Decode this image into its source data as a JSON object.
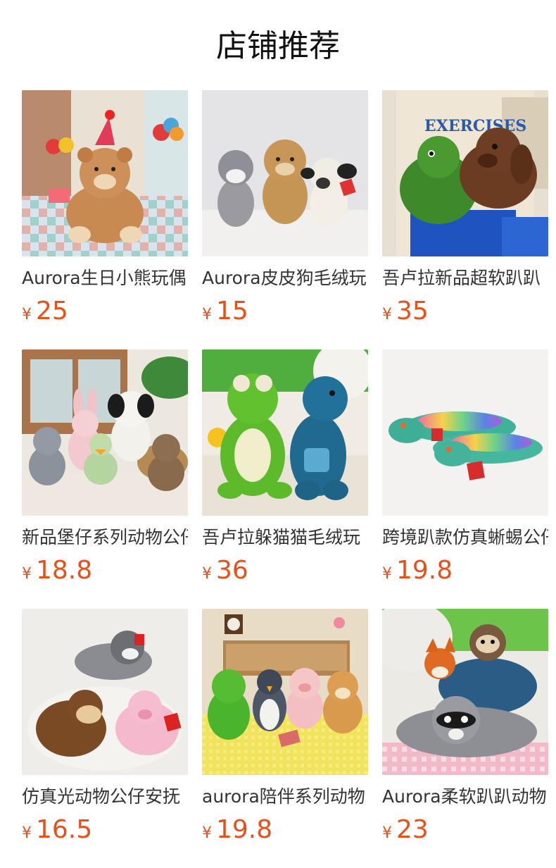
{
  "page_title": "店铺推荐",
  "currency_symbol": "¥",
  "accent_color": "#e8501a",
  "products": [
    {
      "name": "Aurora生日小熊玩偶",
      "price": "25",
      "image": "birthday-bear-image"
    },
    {
      "name": "Aurora皮皮狗毛绒玩",
      "price": "15",
      "image": "puppy-trio-image"
    },
    {
      "name": "吾卢拉新品超软趴趴",
      "price": "35",
      "image": "dino-dog-plush-image"
    },
    {
      "name": "新品堡仔系列动物公仔",
      "price": "18.8",
      "image": "animal-family-image"
    },
    {
      "name": "吾卢拉躲猫猫毛绒玩",
      "price": "36",
      "image": "frog-dino-image"
    },
    {
      "name": "跨境趴款仿真蜥蜴公仔",
      "price": "19.8",
      "image": "lizard-plush-image"
    },
    {
      "name": "仿真光动物公仔安抚",
      "price": "16.5",
      "image": "husky-monkey-pig-image"
    },
    {
      "name": "aurora陪伴系列动物",
      "price": "19.8",
      "image": "companion-series-image"
    },
    {
      "name": "Aurora柔软趴趴动物",
      "price": "23",
      "image": "raccoon-fox-sloth-image"
    }
  ]
}
